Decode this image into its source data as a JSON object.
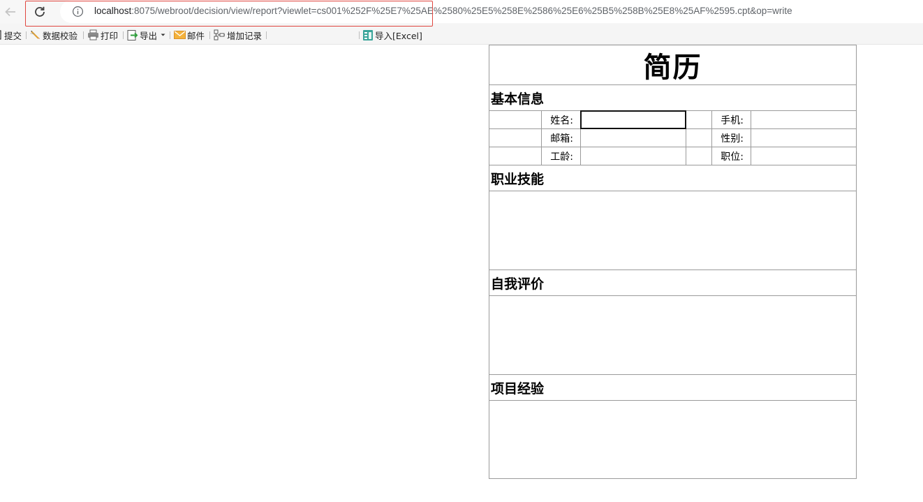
{
  "browser": {
    "url_host": "localhost",
    "url_rest": ":8075/webroot/decision/view/report?viewlet=cs001%252F%25E7%25AE%2580%25E5%258E%2586%25E6%25B5%258B%25E8%25AF%2595.cpt&op=write"
  },
  "toolbar": {
    "submit": "提交",
    "validate": "数据校验",
    "print": "打印",
    "export": "导出",
    "email": "邮件",
    "add_record": "增加记录",
    "import_excel": "导入[Excel]"
  },
  "report": {
    "title": "简历",
    "section_basic": "基本信息",
    "labels": {
      "name": "姓名:",
      "phone": "手机:",
      "email": "邮箱:",
      "gender": "性别:",
      "seniority": "工龄:",
      "position": "职位:"
    },
    "section_skills": "职业技能",
    "section_self_eval": "自我评价",
    "section_projects": "项目经验"
  },
  "colors": {
    "highlight": "#e0463f",
    "grid": "#9a9a9a"
  }
}
